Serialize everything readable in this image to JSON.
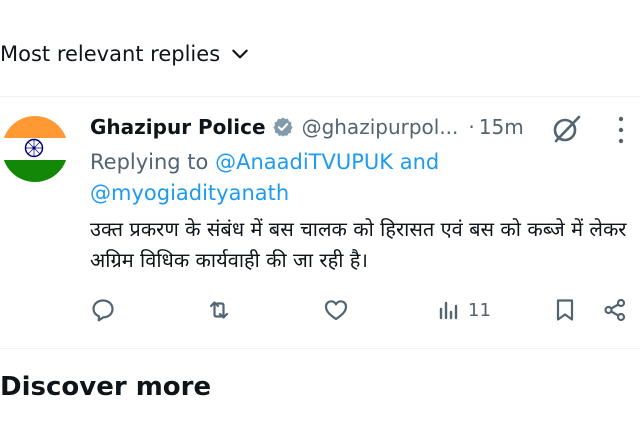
{
  "sort": {
    "label": "Most relevant replies"
  },
  "tweet": {
    "author_name": "Ghazipur Police",
    "handle": "@ghazipurpol...",
    "separator": "·",
    "time": "15m",
    "replying_to_prefix": "Replying to",
    "mention_1": "@AnaadiTVUPUK",
    "conjunction": "and",
    "mention_2": "@myogiadityanath",
    "text": "उक्त प्रकरण के संबंध में बस चालक को हिरासत एवं बस को कब्जे में लेकर अग्रिम विधिक कार्यवाही की जा रही है।",
    "views_count": "11"
  },
  "discover": {
    "title": "Discover more"
  },
  "colors": {
    "accent": "#1d9bf0",
    "secondary_text": "#536471",
    "saffron": "#ff9933",
    "green": "#138808",
    "chakra": "#000080"
  },
  "icons": [
    "chevron-down-icon",
    "verified-badge-icon",
    "grok-icon",
    "more-icon",
    "reply-icon",
    "retweet-icon",
    "like-icon",
    "views-icon",
    "bookmark-icon",
    "share-icon"
  ]
}
